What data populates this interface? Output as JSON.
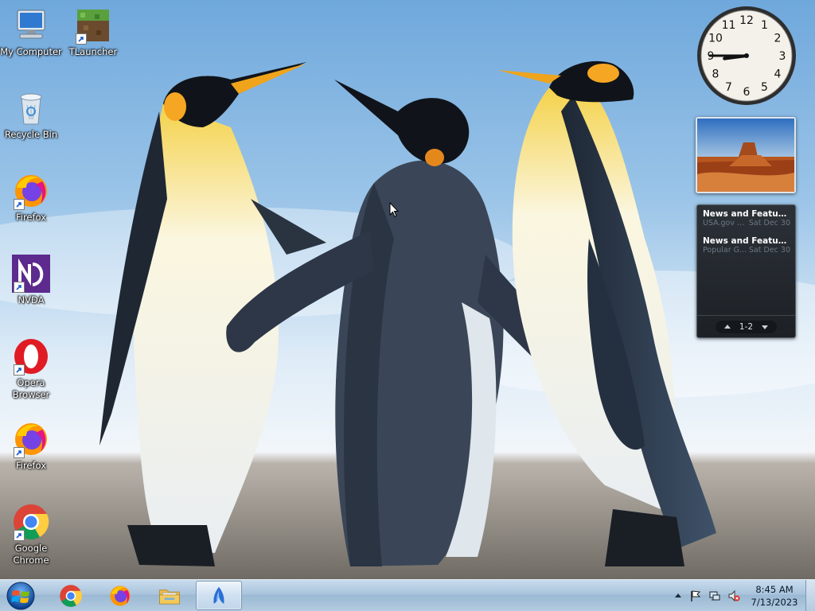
{
  "desktop": {
    "icons": [
      {
        "label": "My Computer",
        "icon": "computer-icon",
        "shortcut": false
      },
      {
        "label": "TLauncher",
        "icon": "tlauncher-icon",
        "shortcut": true
      },
      {
        "label": "Recycle Bin",
        "icon": "recycle-bin-icon",
        "shortcut": false
      },
      {
        "label": "Firefox",
        "icon": "firefox-icon",
        "shortcut": true
      },
      {
        "label": "NVDA",
        "icon": "nvda-icon",
        "shortcut": true
      },
      {
        "label": "Opera Browser",
        "icon": "opera-icon",
        "shortcut": true
      },
      {
        "label": "Firefox",
        "icon": "firefox-icon",
        "shortcut": true
      },
      {
        "label": "Google Chrome",
        "icon": "chrome-icon",
        "shortcut": true
      }
    ],
    "wallpaper": "emperor-penguins-wallpaper"
  },
  "gadgets": {
    "clock": {
      "numerals": [
        "12",
        "1",
        "2",
        "3",
        "4",
        "5",
        "6",
        "7",
        "8",
        "9",
        "10",
        "11"
      ],
      "hour": 8,
      "minute": 45
    },
    "slideshow": {
      "image": "desert-butte-photo"
    },
    "feed": {
      "items": [
        {
          "title": "News and Features f...",
          "source": "USA.gov U...",
          "date": "Sat Dec 30"
        },
        {
          "title": "News and Feature...",
          "source": "Popular G...",
          "date": "Sat Dec 30"
        }
      ],
      "pager": "1-2"
    }
  },
  "taskbar": {
    "start": "windows-start-orb",
    "apps": [
      {
        "name": "Google Chrome",
        "icon": "chrome-icon",
        "active": false
      },
      {
        "name": "Firefox",
        "icon": "firefox-icon",
        "active": false
      },
      {
        "name": "Windows Explorer",
        "icon": "folder-icon",
        "active": false
      },
      {
        "name": "NVDA",
        "icon": "nvda-icon",
        "active": true
      }
    ],
    "tray": {
      "icons": [
        "show-hidden-icons-icon",
        "action-center-flag-icon",
        "network-icon",
        "volume-muted-icon"
      ],
      "time": "8:45 AM",
      "date": "7/13/2023"
    }
  },
  "colors": {
    "taskbar": "#a9c4dc",
    "feed_bg": "#2c3138",
    "sky": "#7fb0dc"
  }
}
